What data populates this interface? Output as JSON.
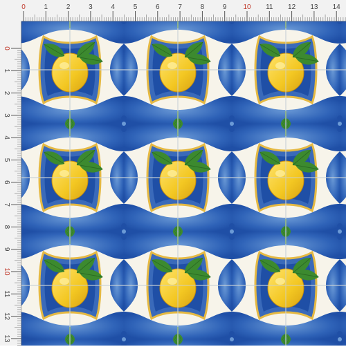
{
  "design": {
    "motif": "lemon-majolica-tile",
    "colors": {
      "tile_blue": "#1f4fa6",
      "tile_light_blue": "#6b9ad6",
      "tile_cream": "#f7f4ea",
      "tile_border_yellow": "#e4b63a",
      "lemon_yellow": "#f3c722",
      "leaf_green": "#3c8a2f",
      "grout_gray": "#c9d1d6"
    }
  },
  "ruler": {
    "unit": "cm",
    "top_labels": [
      "0",
      "1",
      "2",
      "3",
      "4",
      "5",
      "6",
      "7",
      "8",
      "9",
      "10",
      "11",
      "12",
      "13",
      "14"
    ],
    "left_labels": [
      "0",
      "1",
      "2",
      "3",
      "4",
      "5",
      "6",
      "7",
      "8",
      "9",
      "10",
      "11",
      "12",
      "13"
    ]
  }
}
